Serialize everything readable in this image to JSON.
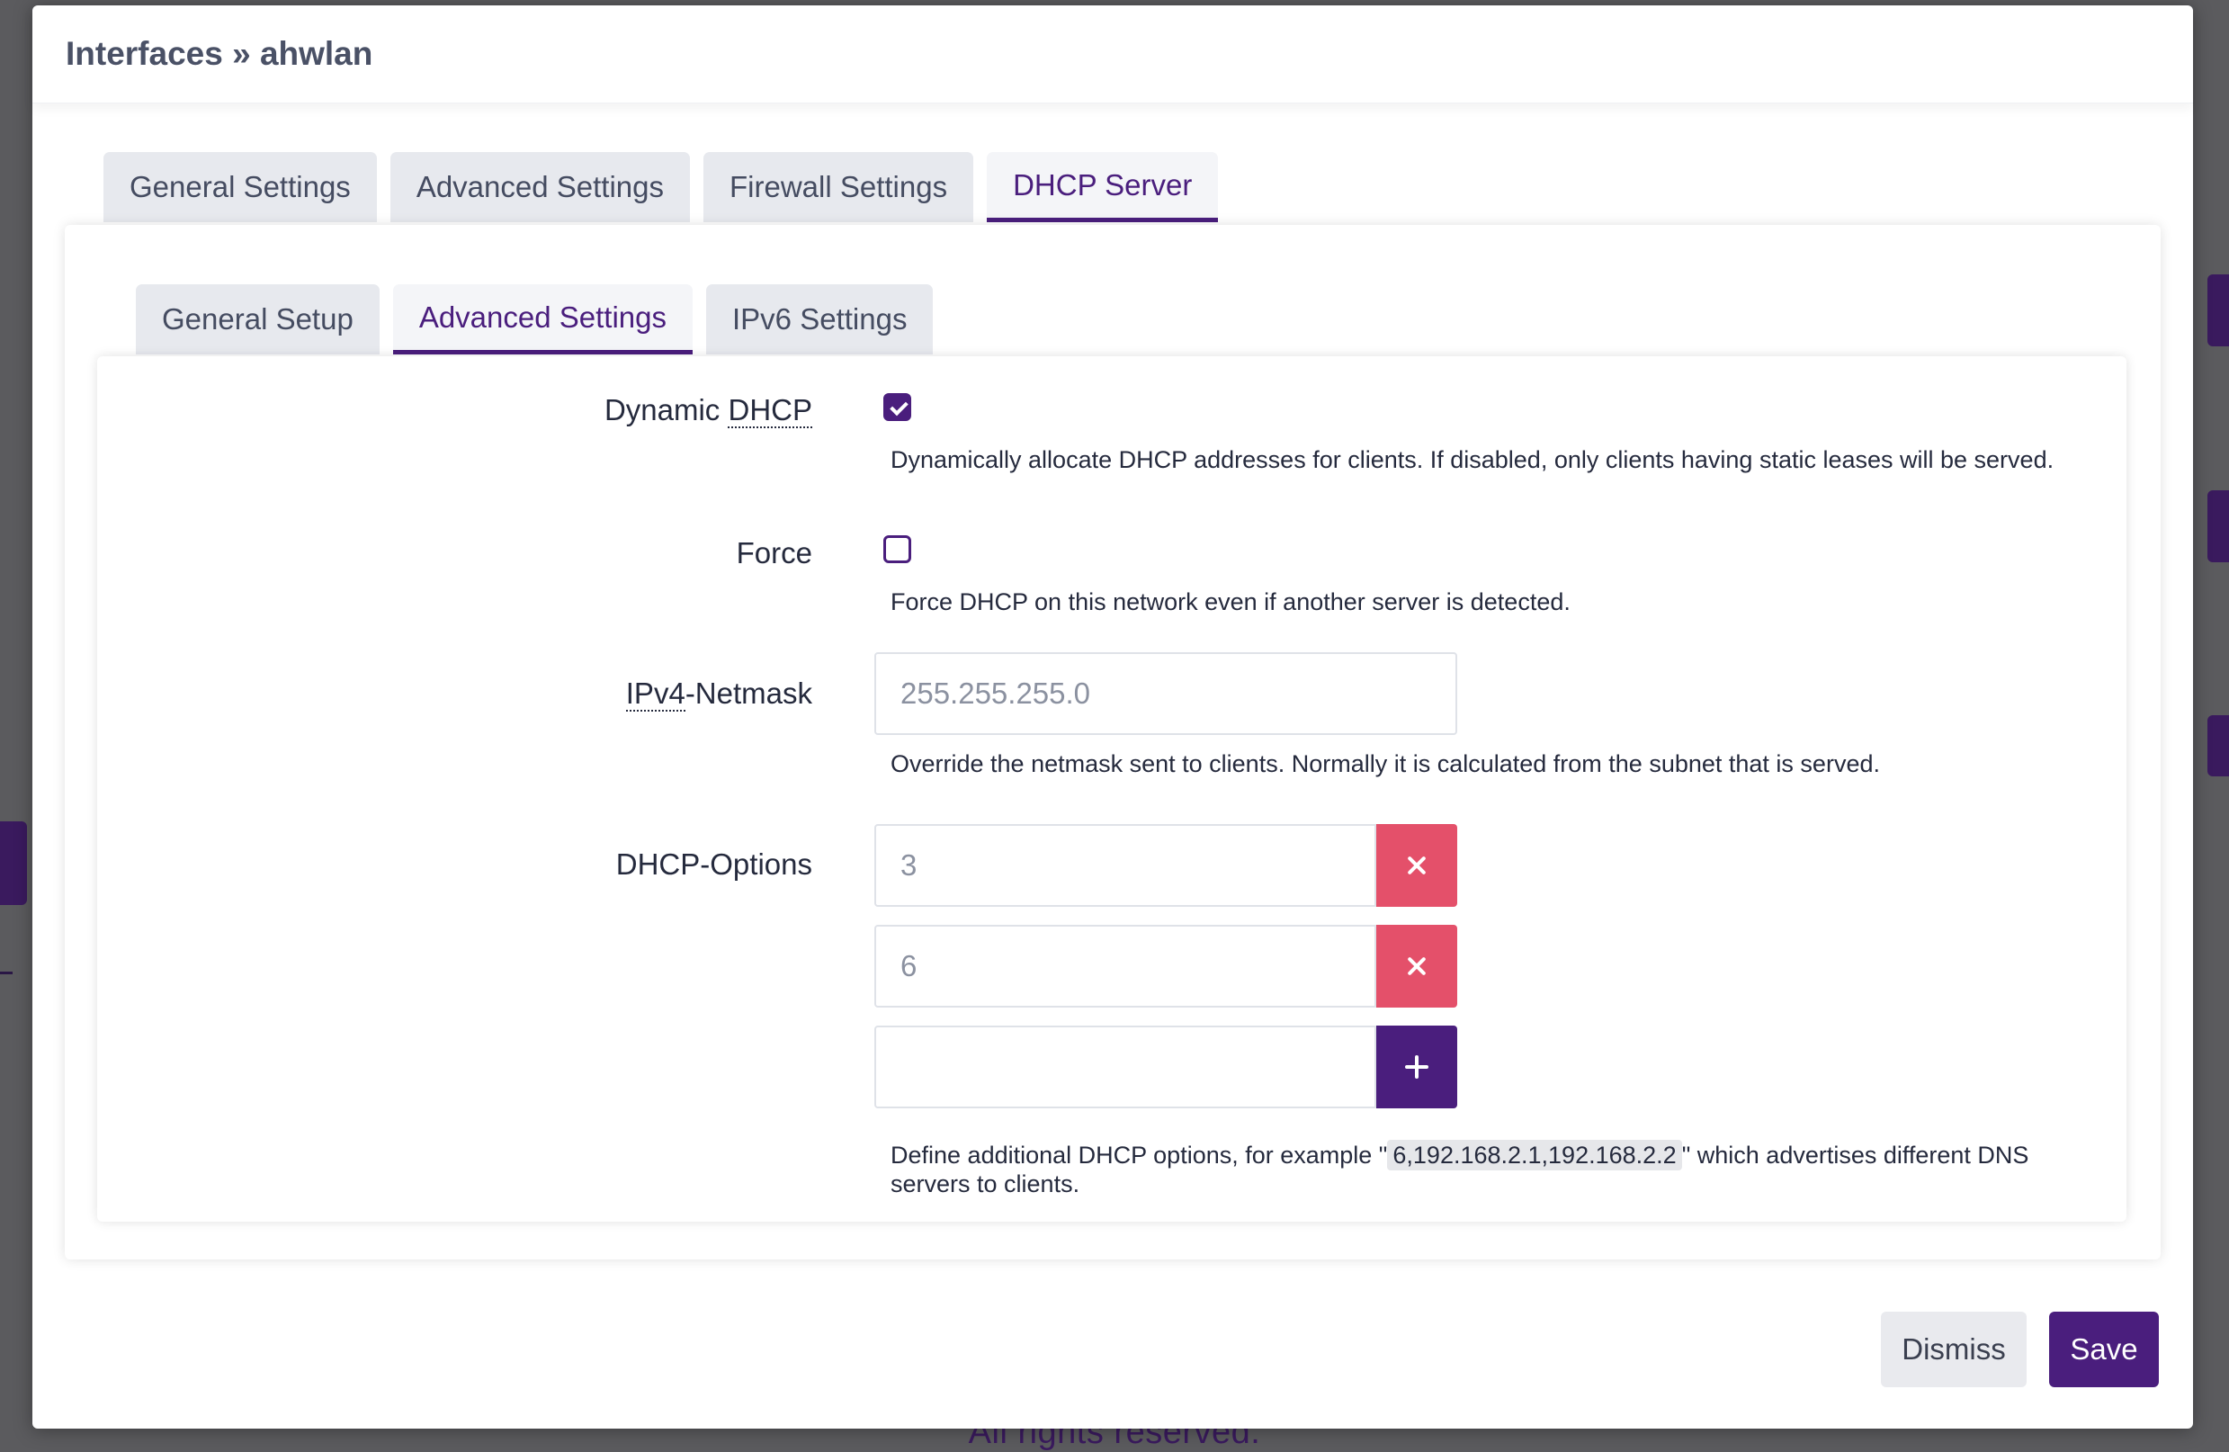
{
  "background": {
    "footer_text": "All rights reserved."
  },
  "modal": {
    "title": "Interfaces » ahwlan",
    "outer_tabs": [
      {
        "label": "General Settings",
        "active": false
      },
      {
        "label": "Advanced Settings",
        "active": false
      },
      {
        "label": "Firewall Settings",
        "active": false
      },
      {
        "label": "DHCP Server",
        "active": true
      }
    ],
    "inner_tabs": [
      {
        "label": "General Setup",
        "active": false
      },
      {
        "label": "Advanced Settings",
        "active": true
      },
      {
        "label": "IPv6 Settings",
        "active": false
      }
    ],
    "fields": {
      "dynamic_dhcp": {
        "label_prefix": "Dynamic ",
        "label_abbr": "DHCP",
        "checked": true,
        "description": "Dynamically allocate DHCP addresses for clients. If disabled, only clients having static leases will be served."
      },
      "force": {
        "label": "Force",
        "checked": false,
        "description": "Force DHCP on this network even if another server is detected."
      },
      "netmask": {
        "label_abbr": "IPv4",
        "label_suffix": "-Netmask",
        "placeholder": "255.255.255.0",
        "description": "Override the netmask sent to clients. Normally it is calculated from the subnet that is served."
      },
      "dhcp_options": {
        "label": "DHCP-Options",
        "values": [
          "3",
          "6",
          ""
        ],
        "description_before": "Define additional DHCP options, for example \"",
        "example": "6,192.168.2.1,192.168.2.2",
        "description_after": "\" which advertises different DNS servers to clients."
      }
    },
    "buttons": {
      "dismiss": "Dismiss",
      "save": "Save"
    }
  },
  "colors": {
    "accent": "#4a1e7d",
    "danger": "#e4506a"
  }
}
